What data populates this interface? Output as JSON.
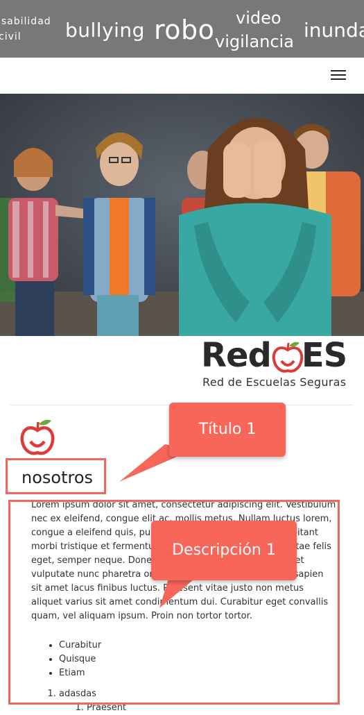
{
  "tag_cloud": {
    "tags": [
      "nsabilidad",
      "civil",
      "bullying",
      "robo",
      "video",
      "vigilancia",
      "inunda"
    ]
  },
  "navbar": {
    "menu_icon": "hamburger-icon"
  },
  "hero": {
    "image": "children-bullying-photo"
  },
  "logo": {
    "wordmark": "RedES",
    "wordmark_left": "Red",
    "wordmark_right": "ES",
    "tagline": "Red de Escuelas Seguras"
  },
  "section": {
    "icon": "apple-icon",
    "title": "nosotros",
    "description": "Lorem ipsum dolor sit amet, consectetur adipiscing elit. Vestibulum nec ex eleifend, congue elit ac, mollis metus. Nullam luctus lorem, congue a eleifend quis, pulvinar vel eros. Pellentesque habitant morbi tristique et fermentum. Etiam dolor velit, posuere vitae felis eget, semper neque. Donec ullamcorper gravida ligula, eget vulputate nunc pharetra orci et ultrices. Quisque placerat sapien sit amet lacus finibus luctus. Praesent vitae justo non metus aliquet varius sit amet condimentum dui. Curabitur eget convallis quam, vel aliquam ipsum. Proin non tortor tortor.",
    "bullets": [
      "Curabitur",
      "Quisque",
      "Etiam"
    ],
    "ordered": [
      "adasdas"
    ],
    "ordered_sub": [
      "Praesent"
    ]
  },
  "annotations": {
    "title_callout": "Título 1",
    "description_callout": "Descripción 1",
    "accent": "#f8665a"
  }
}
